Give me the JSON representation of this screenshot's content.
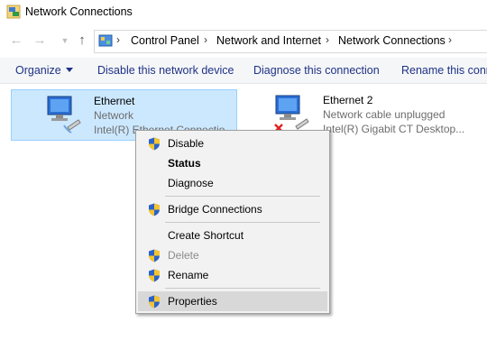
{
  "window": {
    "title": "Network Connections"
  },
  "address": {
    "crumbs": [
      "Control Panel",
      "Network and Internet",
      "Network Connections"
    ]
  },
  "commands": {
    "organize": "Organize",
    "disable": "Disable this network device",
    "diagnose": "Diagnose this connection",
    "rename": "Rename this conn"
  },
  "connections": [
    {
      "name": "Ethernet",
      "status": "Network",
      "device": "Intel(R) Ethernet Connectio"
    },
    {
      "name": "Ethernet 2",
      "status": "Network cable unplugged",
      "device": "Intel(R) Gigabit CT Desktop..."
    }
  ],
  "context_menu": {
    "items": [
      {
        "label": "Disable",
        "shield": true
      },
      {
        "label": "Status",
        "bold": true
      },
      {
        "label": "Diagnose"
      },
      {
        "label": "Bridge Connections",
        "shield": true
      },
      {
        "label": "Create Shortcut"
      },
      {
        "label": "Delete",
        "shield": true,
        "disabled": true
      },
      {
        "label": "Rename",
        "shield": true
      },
      {
        "label": "Properties",
        "shield": true,
        "highlighted": true
      }
    ]
  },
  "colors": {
    "selection": "#cce8ff",
    "command_text": "#1e3287",
    "menu_bg": "#f2f2f2"
  }
}
